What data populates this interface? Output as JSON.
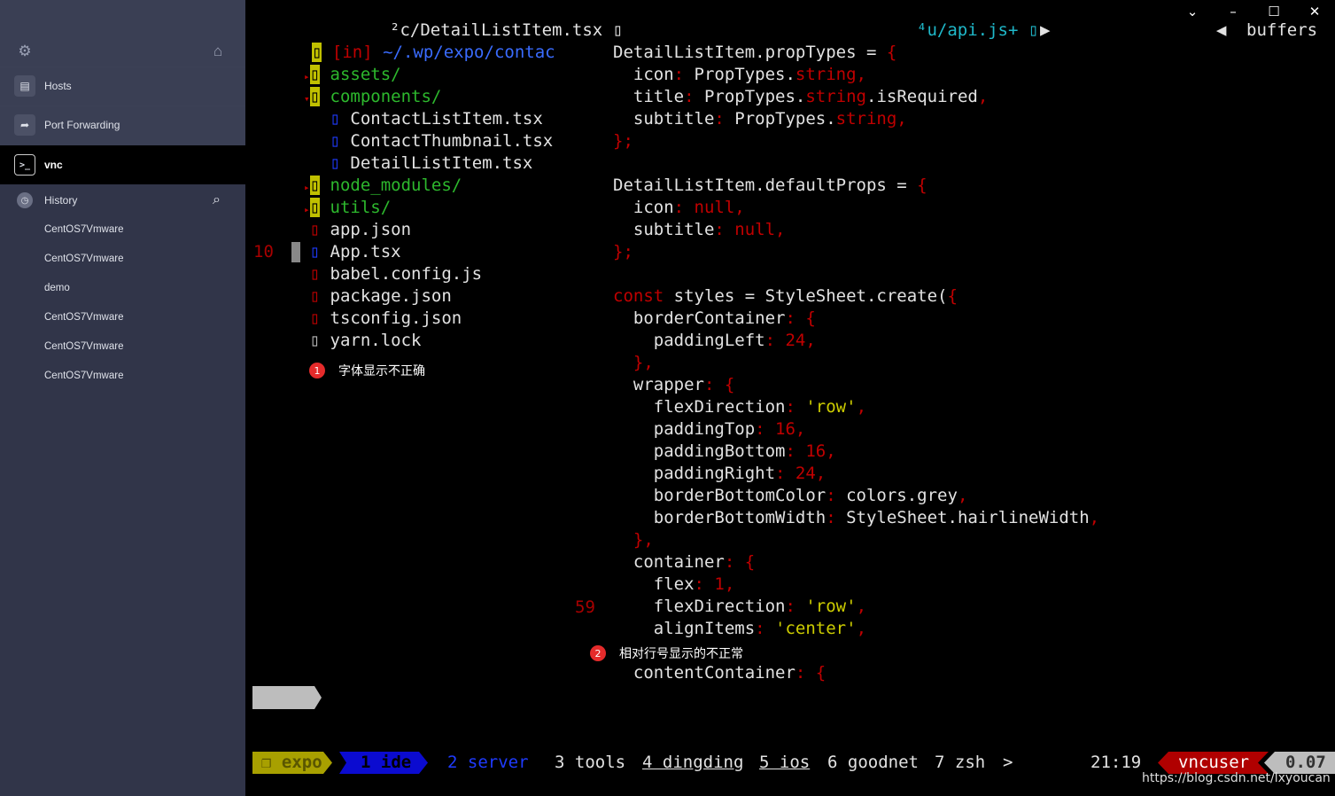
{
  "window": {
    "controls": [
      "chevron-down-icon",
      "minimize-icon",
      "maximize-icon",
      "close-icon"
    ]
  },
  "sidebar": {
    "top_icons": [
      "gear-icon",
      "home-icon"
    ],
    "items": [
      {
        "label": "Hosts",
        "icon": "server-icon"
      },
      {
        "label": "Port Forwarding",
        "icon": "forward-icon"
      },
      {
        "label": "vnc",
        "icon": "terminal-icon"
      }
    ],
    "history": {
      "label": "History",
      "icon": "clock-icon",
      "search_icon": "search-icon",
      "entries": [
        "CentOS7Vmware",
        "CentOS7Vmware",
        "demo",
        "CentOS7Vmware",
        "CentOS7Vmware",
        "CentOS7Vmware"
      ]
    }
  },
  "terminal": {
    "tabs": {
      "left_tab": "²c/DetailListItem.tsx ▯",
      "right_tab": "⁴u/api.js+ ▯",
      "buffers": "buffers"
    },
    "tree": {
      "root_marker": "▯",
      "root": "[in] ~/.wp/expo/contac",
      "entries": [
        {
          "marker": "▸",
          "icon": "▯",
          "name": "assets/",
          "kind": "dir"
        },
        {
          "marker": "▾",
          "icon": "▯",
          "name": "components/",
          "kind": "dir"
        },
        {
          "icon": "▯",
          "name": "ContactListItem.tsx",
          "kind": "tsx",
          "indent": true
        },
        {
          "icon": "▯",
          "name": "ContactThumbnail.tsx",
          "kind": "tsx",
          "indent": true
        },
        {
          "icon": "▯",
          "name": "DetailListItem.tsx",
          "kind": "tsx",
          "indent": true
        },
        {
          "marker": "▸",
          "icon": "▯",
          "name": "node_modules/",
          "kind": "dir"
        },
        {
          "marker": "▸",
          "icon": "▯",
          "name": "utils/",
          "kind": "dir"
        },
        {
          "icon": "▯",
          "name": "app.json",
          "kind": "json"
        },
        {
          "icon": "▯",
          "name": "App.tsx",
          "kind": "tsx",
          "lineno": "10"
        },
        {
          "icon": "▯",
          "name": "babel.config.js",
          "kind": "json"
        },
        {
          "icon": "▯",
          "name": "package.json",
          "kind": "json"
        },
        {
          "icon": "▯",
          "name": "tsconfig.json",
          "kind": "json"
        },
        {
          "icon": "▯",
          "name": "yarn.lock",
          "kind": "lock"
        }
      ]
    },
    "notes": [
      {
        "num": "1",
        "text": "字体显示不正确"
      },
      {
        "num": "2",
        "text": "相对行号显示的不正常"
      }
    ],
    "code_lineno": "59",
    "code": [
      [
        [
          "w",
          "DetailListItem.propTypes = "
        ],
        [
          "r",
          "{"
        ]
      ],
      [
        [
          "w",
          "  icon"
        ],
        [
          "r",
          ": "
        ],
        [
          "w",
          "PropTypes."
        ],
        [
          "r",
          "string,"
        ]
      ],
      [
        [
          "w",
          "  title"
        ],
        [
          "r",
          ": "
        ],
        [
          "w",
          "PropTypes."
        ],
        [
          "r",
          "string"
        ],
        [
          "w",
          ".isRequired"
        ],
        [
          "r",
          ","
        ]
      ],
      [
        [
          "w",
          "  subtitle"
        ],
        [
          "r",
          ": "
        ],
        [
          "w",
          "PropTypes."
        ],
        [
          "r",
          "string,"
        ]
      ],
      [
        [
          "r",
          "};"
        ]
      ],
      [
        [
          "w",
          ""
        ]
      ],
      [
        [
          "w",
          "DetailListItem.defaultProps = "
        ],
        [
          "r",
          "{"
        ]
      ],
      [
        [
          "w",
          "  icon"
        ],
        [
          "r",
          ": null,"
        ]
      ],
      [
        [
          "w",
          "  subtitle"
        ],
        [
          "r",
          ": null,"
        ]
      ],
      [
        [
          "r",
          "};"
        ]
      ],
      [
        [
          "w",
          ""
        ]
      ],
      [
        [
          "r",
          "const "
        ],
        [
          "w",
          "styles = StyleSheet.create("
        ],
        [
          "r",
          "{"
        ]
      ],
      [
        [
          "w",
          "  borderContainer"
        ],
        [
          "r",
          ": {"
        ]
      ],
      [
        [
          "w",
          "    paddingLeft"
        ],
        [
          "r",
          ": 24,"
        ]
      ],
      [
        [
          "r",
          "  },"
        ]
      ],
      [
        [
          "w",
          "  wrapper"
        ],
        [
          "r",
          ": {"
        ]
      ],
      [
        [
          "w",
          "    flexDirection"
        ],
        [
          "r",
          ": "
        ],
        [
          "y",
          "'row'"
        ],
        [
          "r",
          ","
        ]
      ],
      [
        [
          "w",
          "    paddingTop"
        ],
        [
          "r",
          ": 16,"
        ]
      ],
      [
        [
          "w",
          "    paddingBottom"
        ],
        [
          "r",
          ": 16,"
        ]
      ],
      [
        [
          "w",
          "    paddingRight"
        ],
        [
          "r",
          ": 24,"
        ]
      ],
      [
        [
          "w",
          "    borderBottomColor"
        ],
        [
          "r",
          ": "
        ],
        [
          "w",
          "colors.grey"
        ],
        [
          "r",
          ","
        ]
      ],
      [
        [
          "w",
          "    borderBottomWidth"
        ],
        [
          "r",
          ": "
        ],
        [
          "w",
          "StyleSheet.hairlineWidth"
        ],
        [
          "r",
          ","
        ]
      ],
      [
        [
          "r",
          "  },"
        ]
      ],
      [
        [
          "w",
          "  container"
        ],
        [
          "r",
          ": {"
        ]
      ],
      [
        [
          "w",
          "    flex"
        ],
        [
          "r",
          ": 1,"
        ]
      ],
      [
        [
          "w",
          "    flexDirection"
        ],
        [
          "r",
          ": "
        ],
        [
          "y",
          "'row'"
        ],
        [
          "r",
          ","
        ]
      ],
      [
        [
          "w",
          "    alignItems"
        ],
        [
          "r",
          ": "
        ],
        [
          "y",
          "'center'"
        ],
        [
          "r",
          ","
        ]
      ],
      [
        [
          "w",
          ""
        ]
      ],
      [
        [
          "w",
          "  contentContainer"
        ],
        [
          "r",
          ": {"
        ]
      ]
    ],
    "statusbar": {
      "session": "❐ expo",
      "win1": "1 ide",
      "win2": "2 server",
      "win3": "3 tools",
      "win4": "4 dingding",
      "win5": "5 ios",
      "win6": "6 goodnet",
      "win7": "7 zsh",
      "more": ">",
      "time": "21:19",
      "user": "vncuser",
      "load": "0.07"
    },
    "watermark": "https://blog.csdn.net/lxyoucan"
  }
}
